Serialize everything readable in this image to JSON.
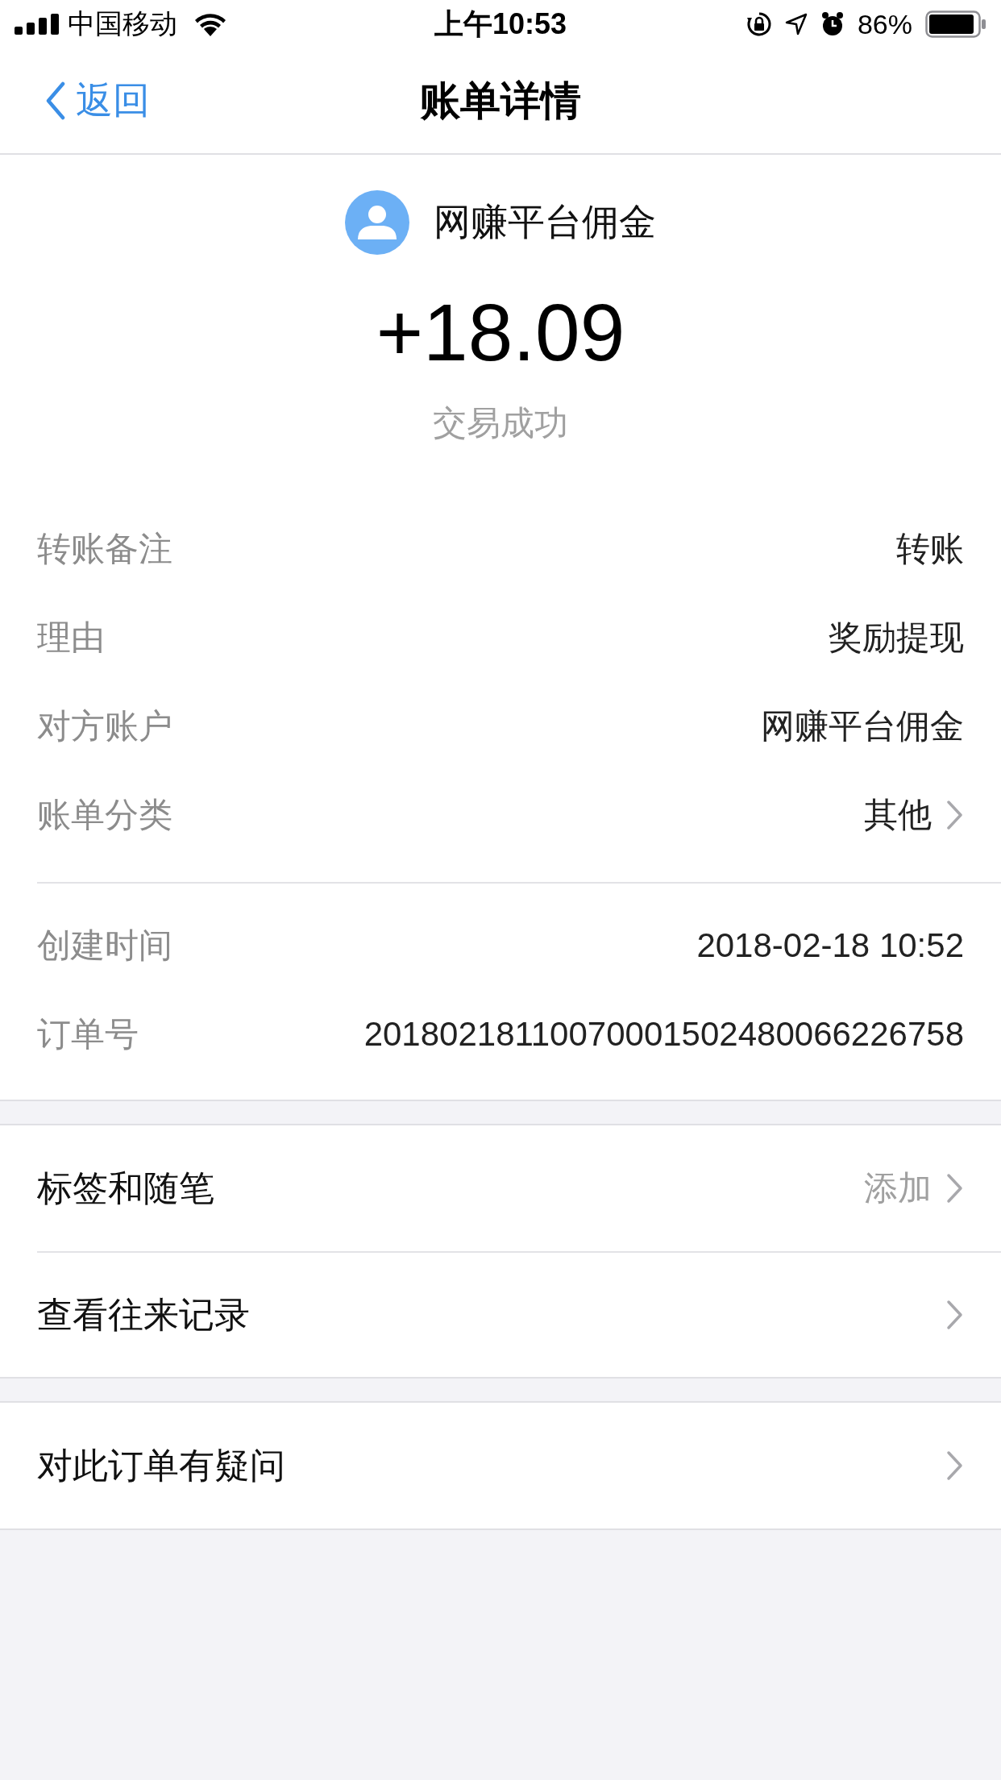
{
  "status_bar": {
    "carrier": "中国移动",
    "time": "上午10:53",
    "battery": "86%"
  },
  "nav": {
    "back": "返回",
    "title": "账单详情"
  },
  "header": {
    "name": "网赚平台佣金",
    "amount": "+18.09",
    "status": "交易成功"
  },
  "details": [
    {
      "label": "转账备注",
      "value": "转账",
      "has_arrow": false
    },
    {
      "label": "理由",
      "value": "奖励提现",
      "has_arrow": false
    },
    {
      "label": "对方账户",
      "value": "网赚平台佣金",
      "has_arrow": false
    },
    {
      "label": "账单分类",
      "value": "其他",
      "has_arrow": true
    }
  ],
  "details_2": [
    {
      "label": "创建时间",
      "value": "2018-02-18 10:52",
      "has_arrow": false
    },
    {
      "label": "订单号",
      "value": "20180218110070001502480066226758",
      "has_arrow": false
    }
  ],
  "action_groups": [
    [
      {
        "label": "标签和随笔",
        "hint": "添加",
        "has_arrow": true
      },
      {
        "label": "查看往来记录",
        "has_arrow": true
      }
    ],
    [
      {
        "label": "对此订单有疑问",
        "has_arrow": true
      }
    ]
  ]
}
